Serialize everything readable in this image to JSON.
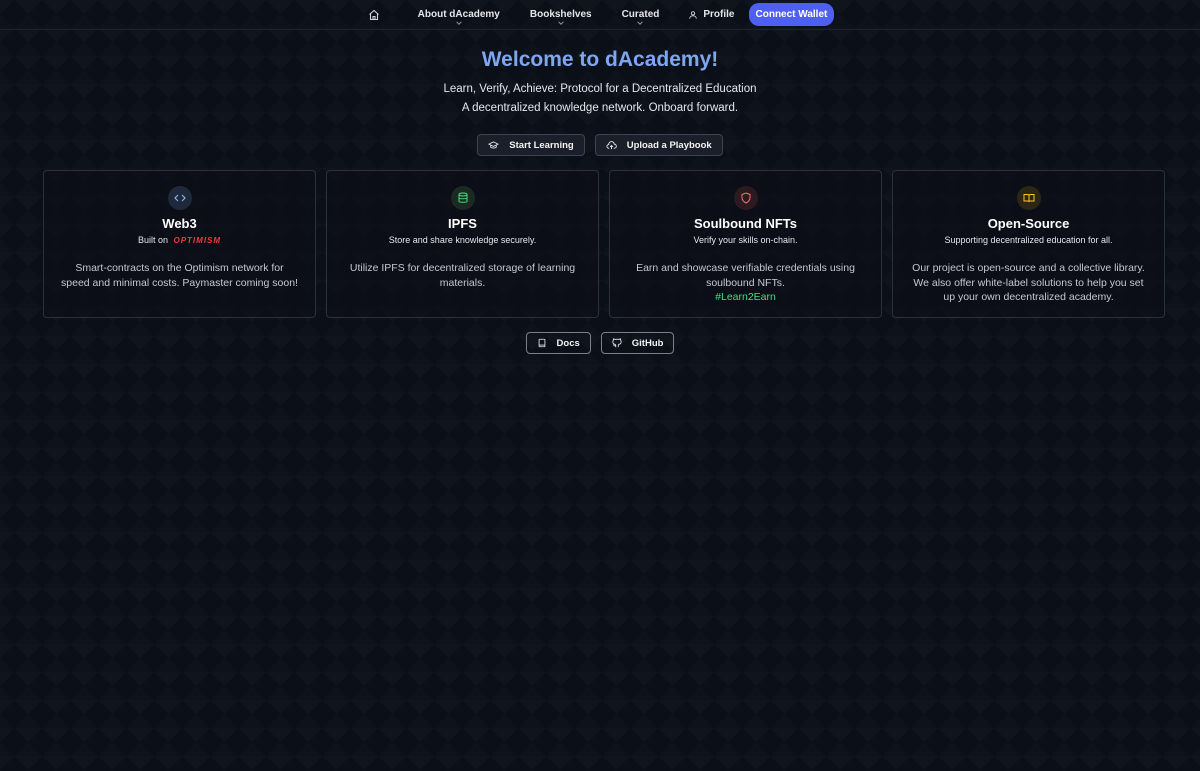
{
  "nav": {
    "home_icon": "home-icon",
    "items": [
      {
        "label": "About dAcademy"
      },
      {
        "label": "Bookshelves"
      },
      {
        "label": "Curated"
      }
    ],
    "profile_label": "Profile",
    "connect_label": "Connect Wallet"
  },
  "hero": {
    "title": "Welcome to dAcademy!",
    "tagline": "Learn, Verify, Achieve: Protocol for a Decentralized Education",
    "subtitle": "A decentralized knowledge network. Onboard forward.",
    "start_label": "Start Learning",
    "upload_label": "Upload a Playbook"
  },
  "cards": [
    {
      "icon": "code-icon",
      "title": "Web3",
      "sub_prefix": "Built on",
      "sub_logo": "OPTIMISM",
      "desc": "Smart-contracts on the Optimism network for speed and minimal costs. Paymaster coming soon!"
    },
    {
      "icon": "database-icon",
      "title": "IPFS",
      "sub": "Store and share knowledge securely.",
      "desc": "Utilize IPFS for decentralized storage of learning materials."
    },
    {
      "icon": "shield-icon",
      "title": "Soulbound NFTs",
      "sub": "Verify your skills on-chain.",
      "desc": "Earn and showcase verifiable credentials using soulbound NFTs.",
      "tag": "#Learn2Earn"
    },
    {
      "icon": "book-icon",
      "title": "Open-Source",
      "sub": "Supporting decentralized education for all.",
      "desc": "Our project is open-source and a collective library. We also offer white-label solutions to help you set up your own decentralized academy."
    }
  ],
  "footer": {
    "docs_label": "Docs",
    "github_label": "GitHub"
  },
  "colors": {
    "accent": "#4f5ff0",
    "title": "#7fa6f3",
    "tag": "#4ade80",
    "optimism": "#ef3b3b"
  }
}
